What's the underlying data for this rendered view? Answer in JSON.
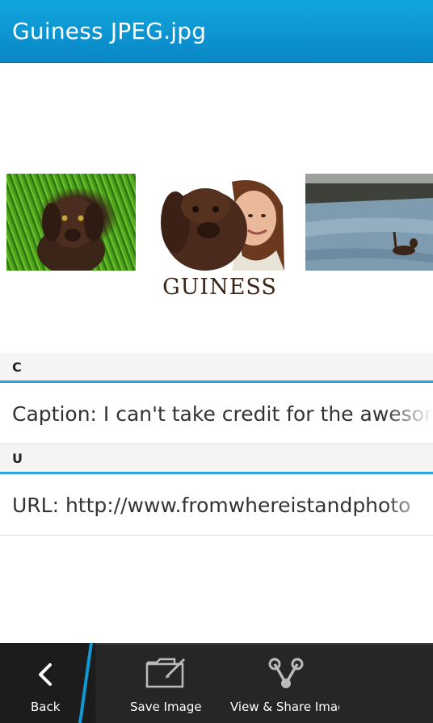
{
  "title": "Guiness JPEG.jpg",
  "gallery": {
    "logo_text": "GUINESS",
    "images": [
      {
        "name": "dog-on-grass-photo"
      },
      {
        "name": "dog-with-woman-photo"
      },
      {
        "name": "dog-in-river-photo"
      }
    ]
  },
  "sections": [
    {
      "header": "C",
      "value": "Caption: I can't take credit for the awesome"
    },
    {
      "header": "U",
      "value": "URL: http://www.fromwhereistandphoto"
    }
  ],
  "actionbar": {
    "back_label": "Back",
    "save_label": "Save Image",
    "share_label": "View & Share Image"
  },
  "colors": {
    "title_bar": "#0a86c6",
    "accent": "#2aa6e0",
    "actionbar": "#262626"
  },
  "icons": [
    "back-chevron-icon",
    "save-folder-icon",
    "share-icon"
  ]
}
